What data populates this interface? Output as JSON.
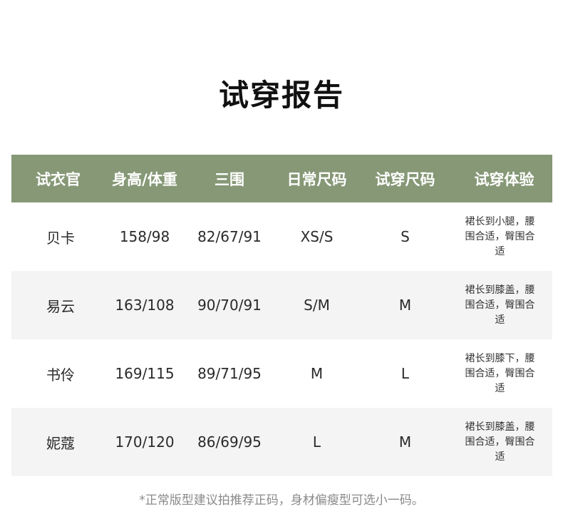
{
  "title": "试穿报告",
  "table": {
    "headers": [
      "试衣官",
      "身高/体重",
      "三围",
      "日常尺码",
      "试穿尺码",
      "试穿体验"
    ],
    "rows": [
      {
        "name": "贝卡",
        "height_weight": "158/98",
        "measurements": "82/67/91",
        "daily_size": "XS/S",
        "trial_size": "S",
        "experience": "裙长到小腿，腰围合适，臀围合适"
      },
      {
        "name": "易云",
        "height_weight": "163/108",
        "measurements": "90/70/91",
        "daily_size": "S/M",
        "trial_size": "M",
        "experience": "裙长到膝盖，腰围合适，臀围合适"
      },
      {
        "name": "书伶",
        "height_weight": "169/115",
        "measurements": "89/71/95",
        "daily_size": "M",
        "trial_size": "L",
        "experience": "裙长到膝下，腰围合适，臀围合适"
      },
      {
        "name": "妮蔻",
        "height_weight": "170/120",
        "measurements": "86/69/95",
        "daily_size": "L",
        "trial_size": "M",
        "experience": "裙长到膝盖，腰围合适，臀围合适"
      }
    ]
  },
  "footnote": "*正常版型建议拍推荐正码，身材偏瘦型可选小一码。",
  "colors": {
    "header_bg": "#869876",
    "header_text": "#ffffff",
    "alt_row_bg": "#f4f4f4"
  }
}
